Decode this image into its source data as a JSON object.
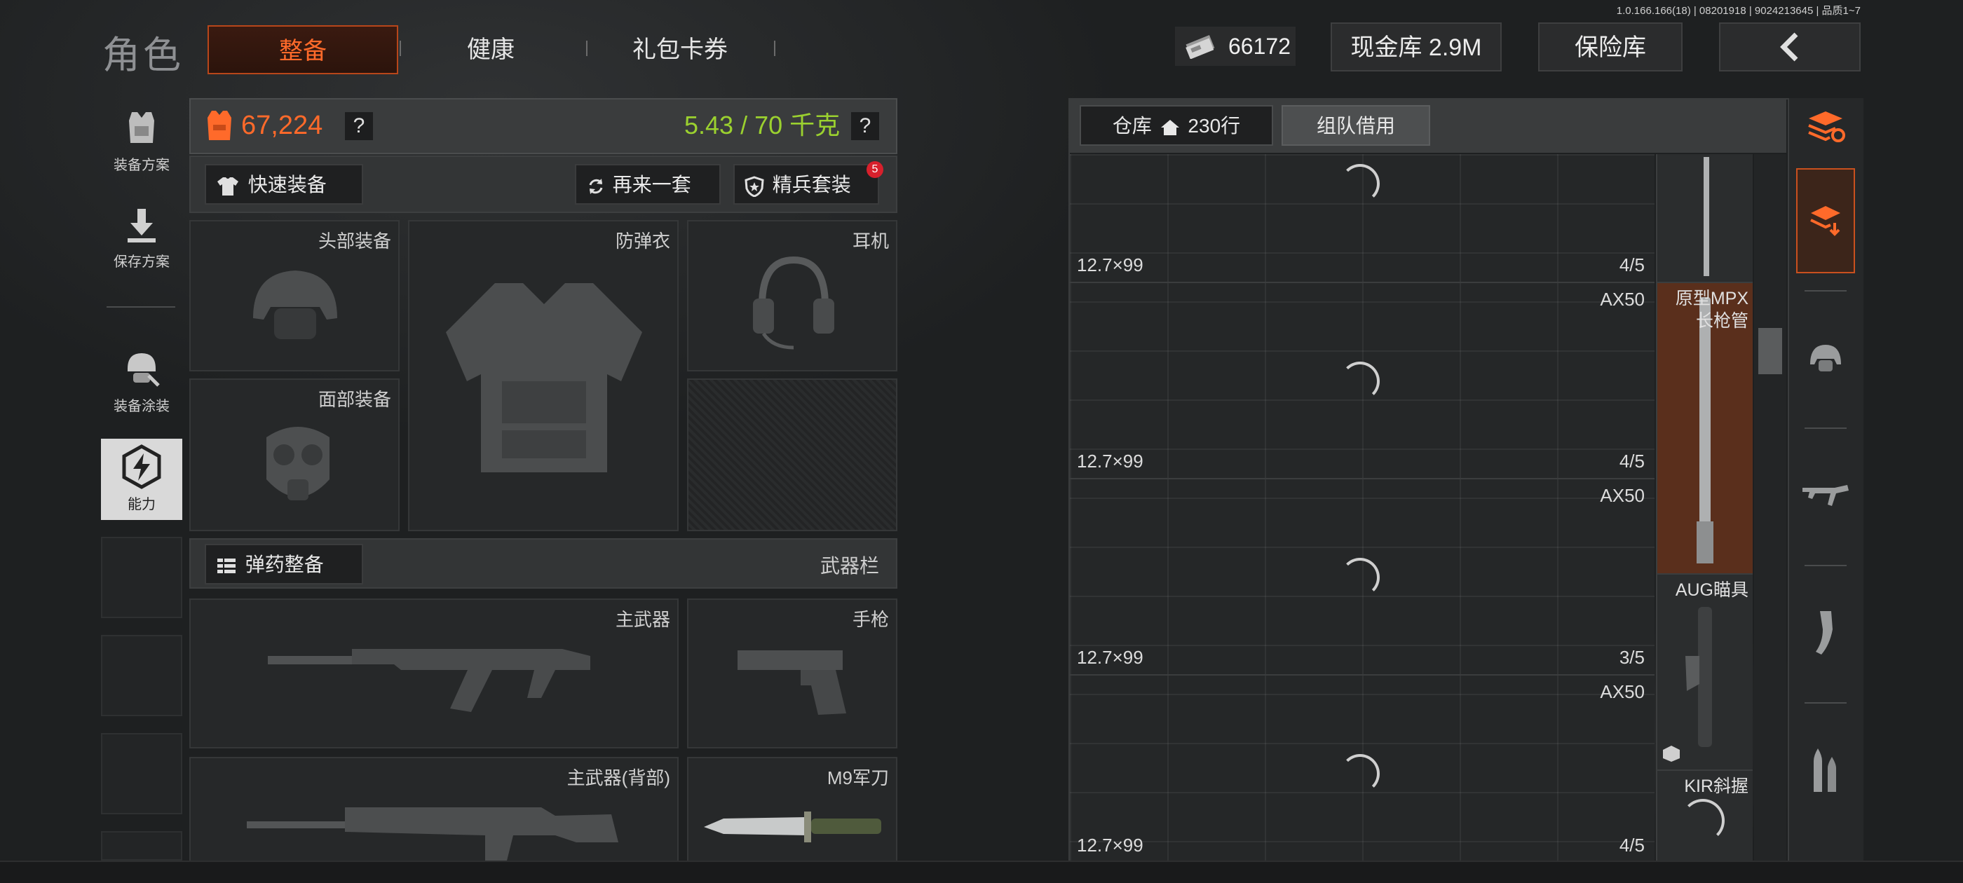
{
  "version": "1.0.166.166(18) | 08201918 | 9024213645 | 品质1~7",
  "header": {
    "title": "角色",
    "tabs": [
      {
        "label": "整备",
        "active": true
      },
      {
        "label": "健康",
        "active": false
      },
      {
        "label": "礼包卡券",
        "active": false
      }
    ],
    "cash_icon": "cash-stack-icon",
    "cash_value": "66172",
    "cash_vault_label": "现金库 2.9M",
    "safe_box_label": "保险库",
    "back_icon": "chevron-left-icon"
  },
  "side_nav": {
    "items": [
      {
        "label": "装备方案",
        "icon": "armor-preset-icon"
      },
      {
        "label": "保存方案",
        "icon": "download-icon"
      },
      {
        "label": "装备涂装",
        "icon": "helmet-paint-icon"
      },
      {
        "label": "能力",
        "icon": "ability-bolt-icon",
        "active": true
      }
    ]
  },
  "equipment": {
    "value": "67,224",
    "value_icon": "armor-vest-icon",
    "weight": "5.43 / 70 千克",
    "help": "?",
    "quick_equip": "快速装备",
    "reroll": "再来一套",
    "elite_kit": "精兵套装",
    "elite_badge": "5",
    "slots": {
      "head": "头部装备",
      "armor": "防弹衣",
      "headset": "耳机",
      "face": "面部装备"
    },
    "ammo_loadout": "弹药整备",
    "weapon_bar": "武器栏",
    "weapon_slots": {
      "primary": "主武器",
      "pistol": "手枪",
      "primary_back": "主武器(背部)",
      "melee": "M9军刀"
    }
  },
  "warehouse": {
    "tab_storage": "仓库",
    "tab_storage_rows": "230行",
    "tab_team": "组队借用",
    "items": [
      {
        "name": "",
        "caliber": "12.7×99",
        "count": "4/5"
      },
      {
        "name": "AX50",
        "caliber": "12.7×99",
        "count": "4/5"
      },
      {
        "name": "AX50",
        "caliber": "12.7×99",
        "count": "3/5"
      },
      {
        "name": "AX50",
        "caliber": "12.7×99",
        "count": "4/5"
      }
    ],
    "side_items": [
      {
        "name": ""
      },
      {
        "name": "原型MPX\n长枪管"
      },
      {
        "name": "AUG瞄具"
      },
      {
        "name": "KIR斜握"
      }
    ]
  },
  "categories": [
    {
      "icon": "layers-refresh-icon"
    },
    {
      "icon": "stack-download-icon",
      "active": true
    },
    {
      "icon": "helmet-icon"
    },
    {
      "icon": "rifle-icon"
    },
    {
      "icon": "magazine-icon"
    },
    {
      "icon": "ammo-icon"
    }
  ],
  "colors": {
    "accent": "#ff6a2a",
    "weight_green": "#9bd12f",
    "badge_red": "#d8202c"
  }
}
